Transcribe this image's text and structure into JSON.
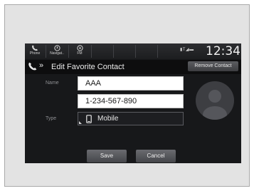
{
  "statusbar": {
    "phone_label": "Phone",
    "navigation_label": "Navigat..",
    "fm_label": "FM",
    "signal_text": "▮T◢▬",
    "clock": "12:34"
  },
  "titlebar": {
    "back_arrow": "»",
    "title": "Edit Favorite Contact",
    "remove_label": "Remove Contact"
  },
  "form": {
    "name_label": "Name",
    "name_value": "AAA",
    "number_value": "1-234-567-890",
    "type_label": "Type",
    "type_value": "Mobile"
  },
  "actions": {
    "save_label": "Save",
    "cancel_label": "Cancel"
  },
  "colors": {
    "screen_bg": "#17181a",
    "button_gray": "#55565a"
  }
}
